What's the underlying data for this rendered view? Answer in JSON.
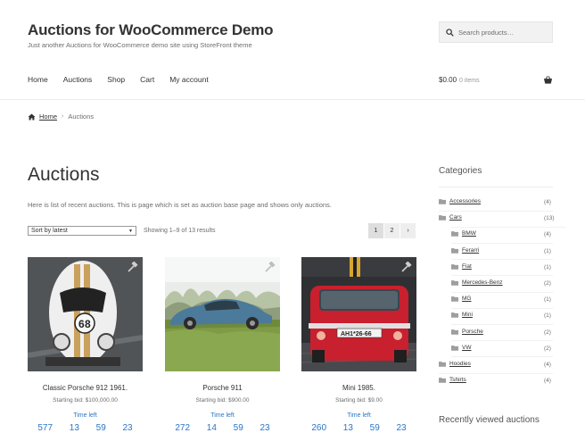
{
  "site": {
    "title": "Auctions for WooCommerce Demo",
    "description": "Just another Auctions for WooCommerce demo site using StoreFront theme"
  },
  "search": {
    "placeholder": "Search products…"
  },
  "nav": [
    "Home",
    "Auctions",
    "Shop",
    "Cart",
    "My account"
  ],
  "cart": {
    "amount": "$0.00",
    "items": "0 items"
  },
  "breadcrumb": {
    "home": "Home",
    "separator": "›",
    "current": "Auctions"
  },
  "page": {
    "title": "Auctions",
    "intro": "Here is list of recent auctions. This is page which is set as auction base page and shows only auctions."
  },
  "sort": {
    "selected": "Sort by latest"
  },
  "showing": "Showing 1–9 of 13 results",
  "pagination": [
    "1",
    "2",
    "›"
  ],
  "products": [
    {
      "name": "Classic Porsche 912 1961.",
      "bid": "Starting bid: $100,000.00",
      "time_left": "Time left",
      "countdown": [
        "577",
        "13",
        "59",
        "23"
      ]
    },
    {
      "name": "Porsche 911",
      "bid": "Starting bid: $900.00",
      "time_left": "Time left",
      "countdown": [
        "272",
        "14",
        "59",
        "23"
      ]
    },
    {
      "name": "Mini 1985.",
      "bid": "Starting bid: $9.00",
      "time_left": "Time left",
      "countdown": [
        "260",
        "13",
        "59",
        "23"
      ]
    }
  ],
  "mini_plate": "AH1*26-66",
  "sidebar": {
    "categories_title": "Categories",
    "categories": [
      {
        "name": "Accessories",
        "count": "(4)",
        "level": 0
      },
      {
        "name": "Cars",
        "count": "(13)",
        "level": 0
      },
      {
        "name": "BMW",
        "count": "(4)",
        "level": 1
      },
      {
        "name": "Ferarri",
        "count": "(1)",
        "level": 1
      },
      {
        "name": "Fiat",
        "count": "(1)",
        "level": 1
      },
      {
        "name": "Mercedes-Benz",
        "count": "(2)",
        "level": 1
      },
      {
        "name": "MG",
        "count": "(1)",
        "level": 1
      },
      {
        "name": "Mini",
        "count": "(1)",
        "level": 1
      },
      {
        "name": "Porsche",
        "count": "(2)",
        "level": 1
      },
      {
        "name": "VW",
        "count": "(2)",
        "level": 1
      },
      {
        "name": "Hoodies",
        "count": "(4)",
        "level": 0
      },
      {
        "name": "Tshirts",
        "count": "(4)",
        "level": 0
      }
    ],
    "recent_title": "Recently viewed auctions"
  },
  "colors": {
    "link_blue": "#2c75c5",
    "mini_red": "#c8202e",
    "porsche_blue": "#4c7a9a"
  }
}
